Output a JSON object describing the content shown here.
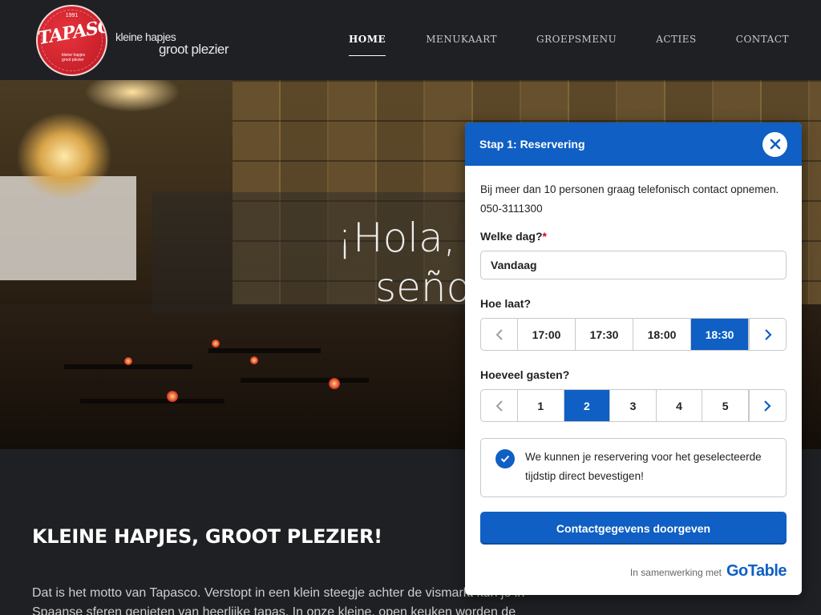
{
  "header": {
    "logo": {
      "year": "1991",
      "word": "TAPASCO",
      "small": "kleine hapjes groot plezier"
    },
    "tagline": {
      "line1": "kleine hapjes",
      "line2": "groot plezier"
    },
    "nav": [
      {
        "label": "HOME",
        "active": true
      },
      {
        "label": "MENUKAART",
        "active": false
      },
      {
        "label": "GROEPSMENU",
        "active": false
      },
      {
        "label": "ACTIES",
        "active": false
      },
      {
        "label": "CONTACT",
        "active": false
      }
    ]
  },
  "hero": {
    "line1": "¡Hola, señor,",
    "line2": "señorita!"
  },
  "content": {
    "title": "KLEINE HAPJES, GROOT PLEZIER!",
    "text": "Dat is het motto van Tapasco. Verstopt in een klein steegje achter de vismarkt kun je in Spaanse sferen genieten van heerlijke tapas. In onze kleine, open keuken worden de"
  },
  "widget": {
    "title": "Stap 1: Reservering",
    "close_icon": "close-icon",
    "info": "Bij meer dan 10 personen graag telefonisch contact opnemen. 050-3111300",
    "day_label": "Welke dag?",
    "day_required": "*",
    "day_value": "Vandaag",
    "time_label": "Hoe laat?",
    "times": [
      "17:00",
      "17:30",
      "18:00",
      "18:30"
    ],
    "time_selected": "18:30",
    "guests_label": "Hoeveel gasten?",
    "guests": [
      "1",
      "2",
      "3",
      "4",
      "5"
    ],
    "guests_selected": "2",
    "confirm_text": "We kunnen je reservering voor het geselecteerde tijdstip direct bevestigen!",
    "button_label": "Contactgegevens doorgeven",
    "footer_pre": "In samenwerking met",
    "footer_brand": "GoTable"
  },
  "colors": {
    "accent": "#0f5fc4",
    "background": "#1f2024",
    "logo_red": "#c8202a"
  }
}
